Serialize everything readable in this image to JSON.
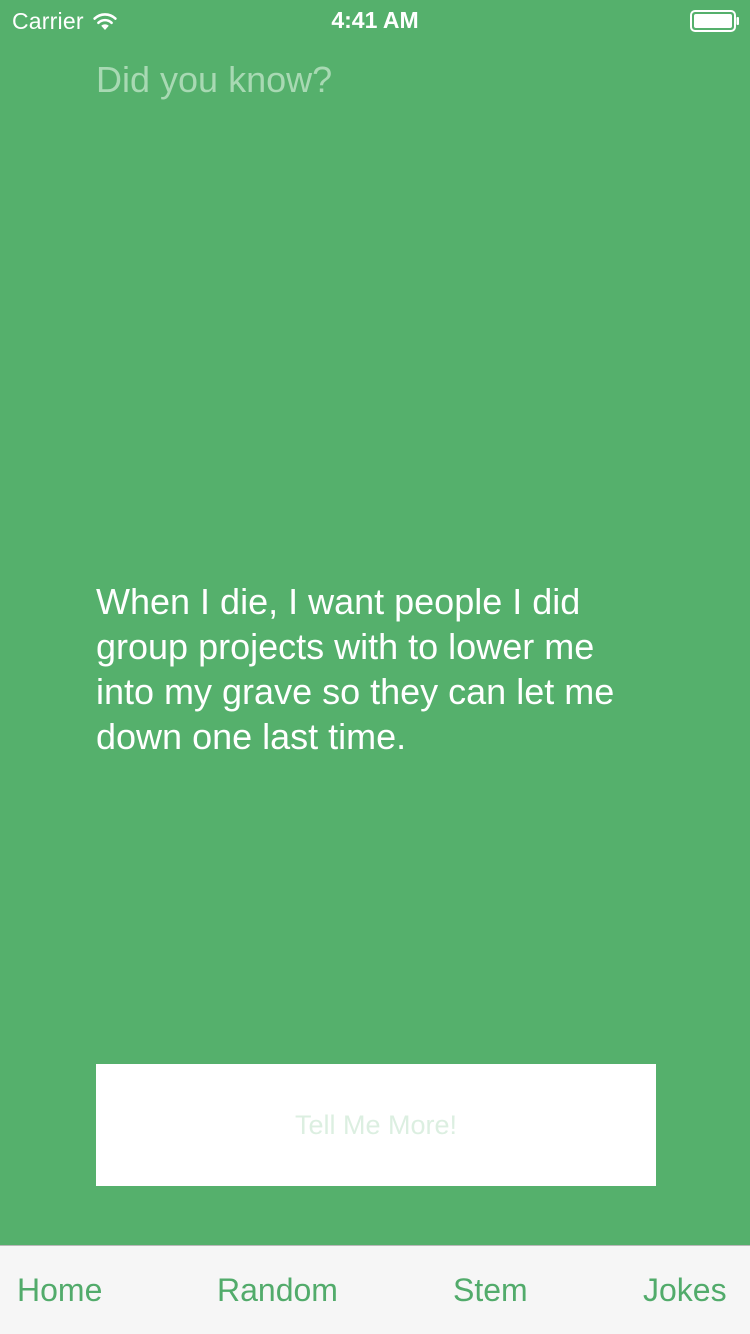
{
  "status_bar": {
    "carrier": "Carrier",
    "time": "4:41 AM",
    "wifi_icon": "wifi-icon",
    "battery_icon": "battery-icon"
  },
  "content": {
    "heading": "Did you know?",
    "fact": "When I die, I want people I did group projects with to lower me into my grave so they can let me down one last time.",
    "button_label": "Tell Me More!"
  },
  "tabs": [
    {
      "label": "Home"
    },
    {
      "label": "Random"
    },
    {
      "label": "Stem"
    },
    {
      "label": "Jokes"
    }
  ],
  "colors": {
    "background": "#55b06c",
    "accent": "#52ab6b",
    "heading": "#a8d9b3",
    "button_text": "#dcefe1",
    "tab_bar": "#f6f6f6"
  }
}
